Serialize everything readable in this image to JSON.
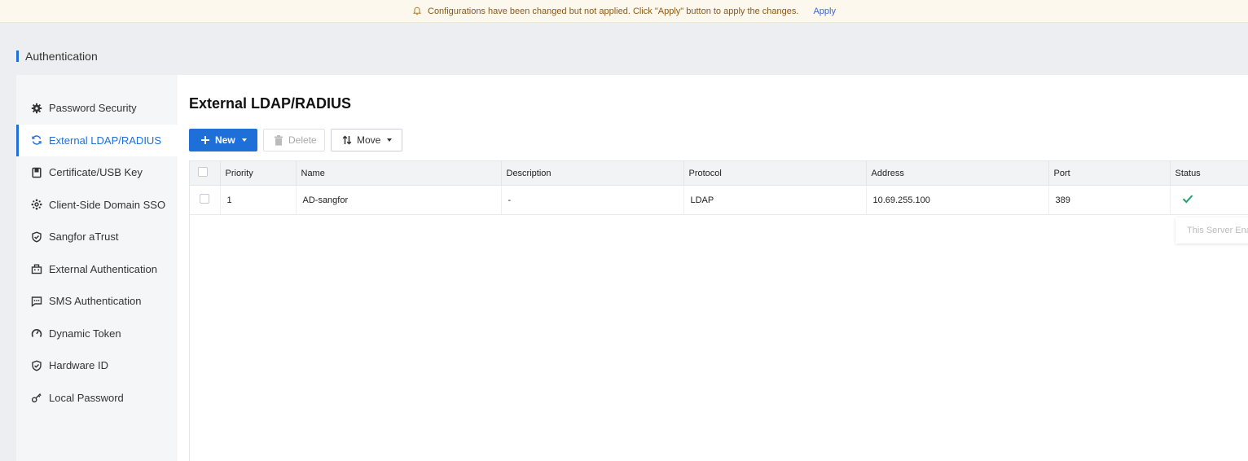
{
  "notice": {
    "message": "Configurations have been changed but not applied. Click \"Apply\" button to apply the changes.",
    "apply_label": "Apply"
  },
  "page": {
    "title": "Authentication"
  },
  "sidebar": {
    "items": [
      {
        "label": "Password Security",
        "icon": "gear-icon",
        "active": false
      },
      {
        "label": "External LDAP/RADIUS",
        "icon": "sync-icon",
        "active": true
      },
      {
        "label": "Certificate/USB Key",
        "icon": "usb-key-icon",
        "active": false
      },
      {
        "label": "Client-Side Domain SSO",
        "icon": "network-icon",
        "active": false
      },
      {
        "label": "Sangfor aTrust",
        "icon": "shield-check-icon",
        "active": false
      },
      {
        "label": "External Authentication",
        "icon": "building-icon",
        "active": false
      },
      {
        "label": "SMS Authentication",
        "icon": "message-icon",
        "active": false
      },
      {
        "label": "Dynamic Token",
        "icon": "gauge-icon",
        "active": false
      },
      {
        "label": "Hardware ID",
        "icon": "shield-check-icon",
        "active": false
      },
      {
        "label": "Local Password",
        "icon": "key-icon",
        "active": false
      }
    ]
  },
  "main": {
    "heading": "External LDAP/RADIUS",
    "toolbar": {
      "new_label": "New",
      "delete_label": "Delete",
      "move_label": "Move"
    },
    "table": {
      "columns": [
        "Priority",
        "Name",
        "Description",
        "Protocol",
        "Address",
        "Port",
        "Status"
      ],
      "rows": [
        {
          "priority": "1",
          "name": "AD-sangfor",
          "description": "-",
          "protocol": "LDAP",
          "address": "10.69.255.100",
          "port": "389",
          "status": "enabled"
        }
      ]
    },
    "tooltip": "This Server Enabled"
  },
  "colors": {
    "accent": "#1f6fd8",
    "success": "#22a06b",
    "warning_text": "#8a5a16"
  }
}
